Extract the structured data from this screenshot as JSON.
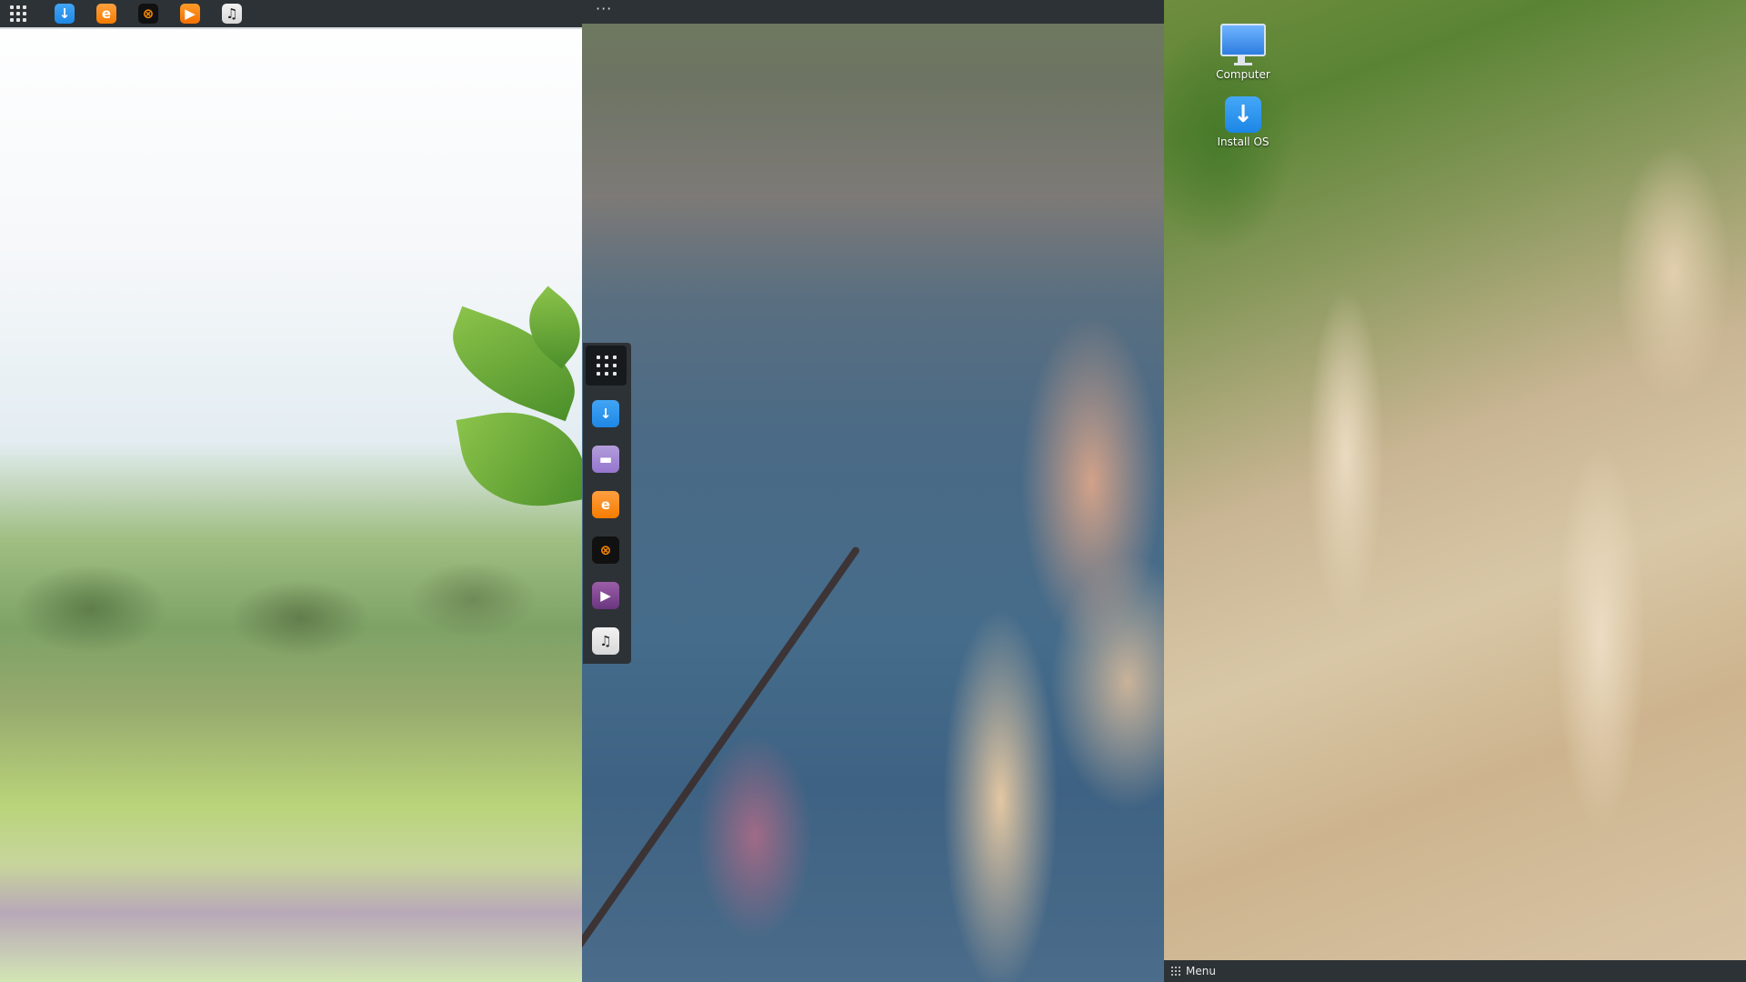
{
  "top_bar": {
    "launcher": {
      "icon": "app-grid-icon"
    },
    "apps": [
      {
        "name": "download",
        "icon": "download-icon",
        "glyph": "↓"
      },
      {
        "name": "firefox",
        "icon": "firefox-icon",
        "glyph": "e"
      },
      {
        "name": "app-x",
        "icon": "x-app-icon",
        "glyph": "⊗"
      },
      {
        "name": "media-player",
        "icon": "play-icon",
        "glyph": "▶"
      },
      {
        "name": "music",
        "icon": "music-icon",
        "glyph": "♫"
      }
    ]
  },
  "middle_window": {
    "title_dots": "···"
  },
  "dock": {
    "launcher": {
      "icon": "app-grid-icon"
    },
    "apps": [
      {
        "name": "download",
        "icon": "download-icon",
        "glyph": "↓"
      },
      {
        "name": "files",
        "icon": "folder-icon",
        "glyph": "▬"
      },
      {
        "name": "firefox",
        "icon": "firefox-icon",
        "glyph": "e"
      },
      {
        "name": "app-x",
        "icon": "x-app-icon",
        "glyph": "⊗"
      },
      {
        "name": "video",
        "icon": "video-play-icon",
        "glyph": "▶"
      },
      {
        "name": "music",
        "icon": "music-icon",
        "glyph": "♫"
      }
    ]
  },
  "desktop": {
    "icons": [
      {
        "label": "Computer",
        "icon": "computer-icon"
      },
      {
        "label": "Install OS",
        "icon": "install-os-icon"
      }
    ]
  },
  "bottom_panel": {
    "menu_label": "Menu",
    "menu_icon": "app-grid-icon"
  }
}
